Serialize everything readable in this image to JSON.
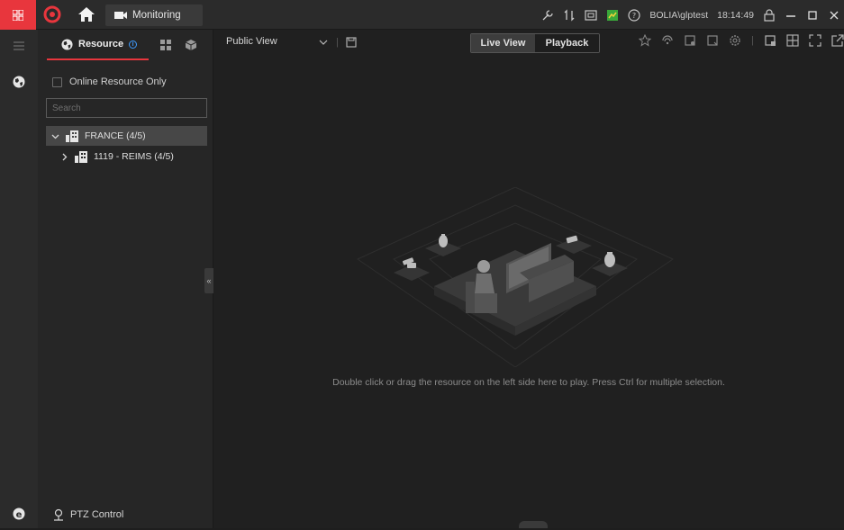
{
  "titlebar": {
    "tab_label": "Monitoring",
    "user": "BOLIA\\glptest",
    "time": "18:14:49",
    "accent": "#e8363d"
  },
  "panel": {
    "tab_resource": "Resource",
    "online_only_label": "Online Resource Only",
    "search_placeholder": "Search",
    "tree": [
      {
        "label": "FRANCE (4/5)",
        "expanded": true,
        "selected": true
      },
      {
        "label": "1119 - REIMS (4/5)",
        "expanded": false,
        "selected": false
      }
    ],
    "ptz_label": "PTZ Control"
  },
  "main": {
    "view_name": "Public View",
    "live_view": "Live View",
    "playback": "Playback",
    "hint": "Double click or drag the resource on the left side here to play. Press Ctrl for multiple selection."
  },
  "icons": [
    "app-menu-icon",
    "logo-icon",
    "home-icon",
    "camera-icon",
    "wrench-icon",
    "transfer-icon",
    "rec-icon",
    "image-icon",
    "help-icon",
    "lock-icon",
    "minimize-icon",
    "maximize-icon",
    "close-icon",
    "list-icon",
    "globe-icon",
    "grid-icon",
    "cube-icon",
    "building-icon",
    "star-icon",
    "save-icon",
    "settings-icon",
    "layout-icon",
    "fullscreen-icon",
    "ptz-icon"
  ]
}
